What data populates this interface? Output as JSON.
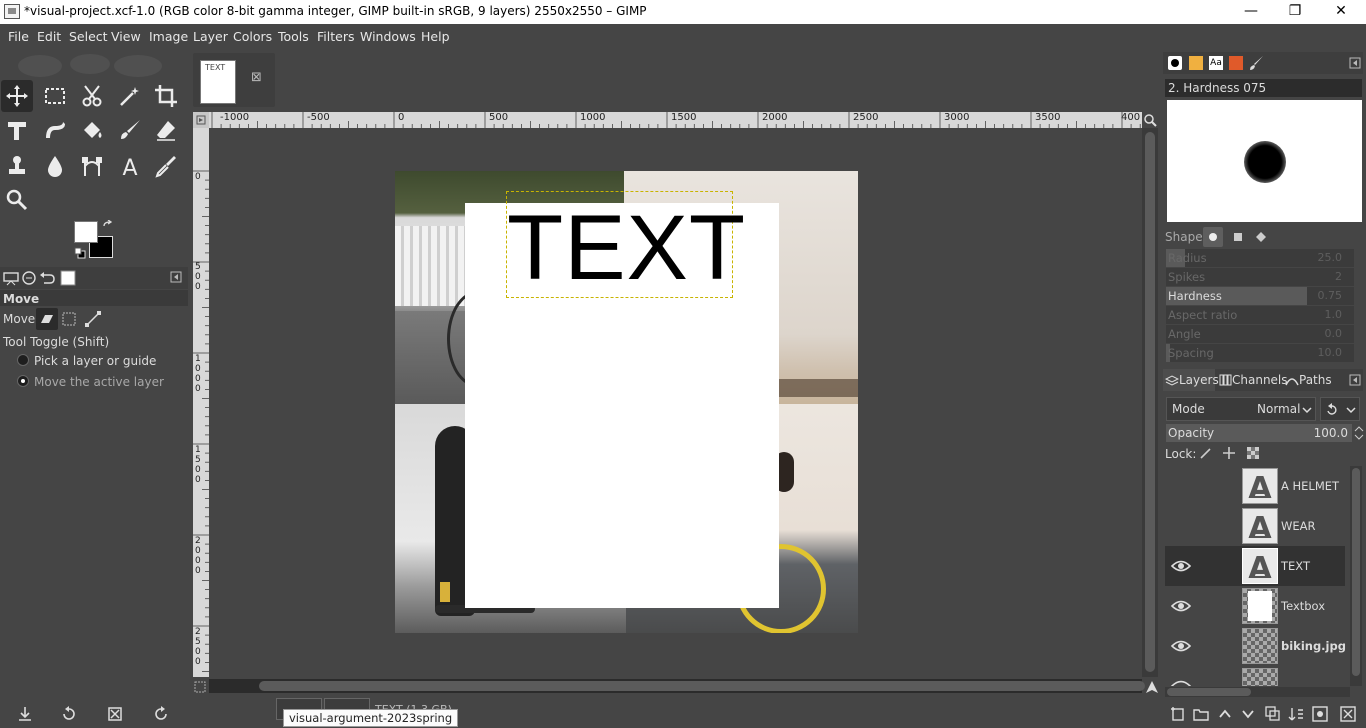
{
  "window": {
    "title": "*visual-project.xcf-1.0 (RGB color 8-bit gamma integer, GIMP built-in sRGB, 9 layers) 2550x2550 – GIMP",
    "minimize": "—",
    "restore": "❐",
    "close": "✕"
  },
  "menubar": [
    "File",
    "Edit",
    "Select",
    "View",
    "Image",
    "Layer",
    "Colors",
    "Tools",
    "Filters",
    "Windows",
    "Help"
  ],
  "toolbox": {
    "tools": [
      "move-tool",
      "rect-select-tool",
      "scissors-select-tool",
      "fuzzy-select-tool",
      "crop-tool",
      "unified-transform-tool",
      "warp-transform-tool",
      "bucket-fill-tool",
      "paintbrush-tool",
      "eraser-tool",
      "clone-tool",
      "smudge-tool",
      "paths-tool",
      "text-tool",
      "color-picker-tool",
      "zoom-tool"
    ],
    "active_tool": "move-tool",
    "foreground_color": "#ffffff",
    "background_color": "#000000"
  },
  "tool_options": {
    "title": "Move",
    "move_label": "Move:",
    "tool_toggle": "Tool Toggle  (Shift)",
    "option_pick": "Pick a layer or guide",
    "option_move_active": "Move the active layer",
    "selected_option": "option_move_active"
  },
  "image_tab": {
    "thumb_text": "TEXT",
    "close_icon": "⊠"
  },
  "ruler": {
    "h_labels": [
      "-1000",
      "-500",
      "0",
      "500",
      "1000",
      "1500",
      "2000",
      "2500",
      "3000",
      "3500",
      "400"
    ],
    "v_labels": [
      "0",
      "5 0 0",
      "1 0 0 0",
      "1 5 0 0",
      "2 0 0 0",
      "2 5 0 0"
    ]
  },
  "canvas": {
    "text_layer_content": "TEXT",
    "text_color": "#000000",
    "textbox_color": "#ffffff",
    "selection_border_color": "#c8b400"
  },
  "status": {
    "tooltip": "visual-argument-2023spring",
    "statusbar_text": "TEXT (1.3 GB)"
  },
  "brushes": {
    "brush_name": "2. Hardness 075",
    "shape_label": "Shape:",
    "sliders": [
      {
        "label": "Radius",
        "value": "25.0",
        "active": false,
        "fill": 0.1
      },
      {
        "label": "Spikes",
        "value": "2",
        "active": false,
        "fill": 0.0
      },
      {
        "label": "Hardness",
        "value": "0.75",
        "active": true,
        "fill": 0.75
      },
      {
        "label": "Aspect ratio",
        "value": "1.0",
        "active": false,
        "fill": 0.0
      },
      {
        "label": "Angle",
        "value": "0.0",
        "active": false,
        "fill": 0.0
      },
      {
        "label": "Spacing",
        "value": "10.0",
        "active": false,
        "fill": 0.02
      }
    ]
  },
  "layers_panel": {
    "tabs": [
      "Layers",
      "Channels",
      "Paths"
    ],
    "mode_label": "Mode",
    "mode_value": "Normal",
    "opacity_label": "Opacity",
    "opacity_value": "100.0",
    "lock_label": "Lock:",
    "layers": [
      {
        "name": "A HELMET",
        "visible": false,
        "thumb": "text",
        "selected": false,
        "bold": false
      },
      {
        "name": "WEAR",
        "visible": false,
        "thumb": "text",
        "selected": false,
        "bold": false
      },
      {
        "name": "TEXT",
        "visible": true,
        "thumb": "text",
        "selected": true,
        "bold": false
      },
      {
        "name": "Textbox",
        "visible": true,
        "thumb": "white",
        "selected": false,
        "bold": false
      },
      {
        "name": "biking.jpg",
        "visible": true,
        "thumb": "checker",
        "selected": false,
        "bold": true
      }
    ]
  }
}
